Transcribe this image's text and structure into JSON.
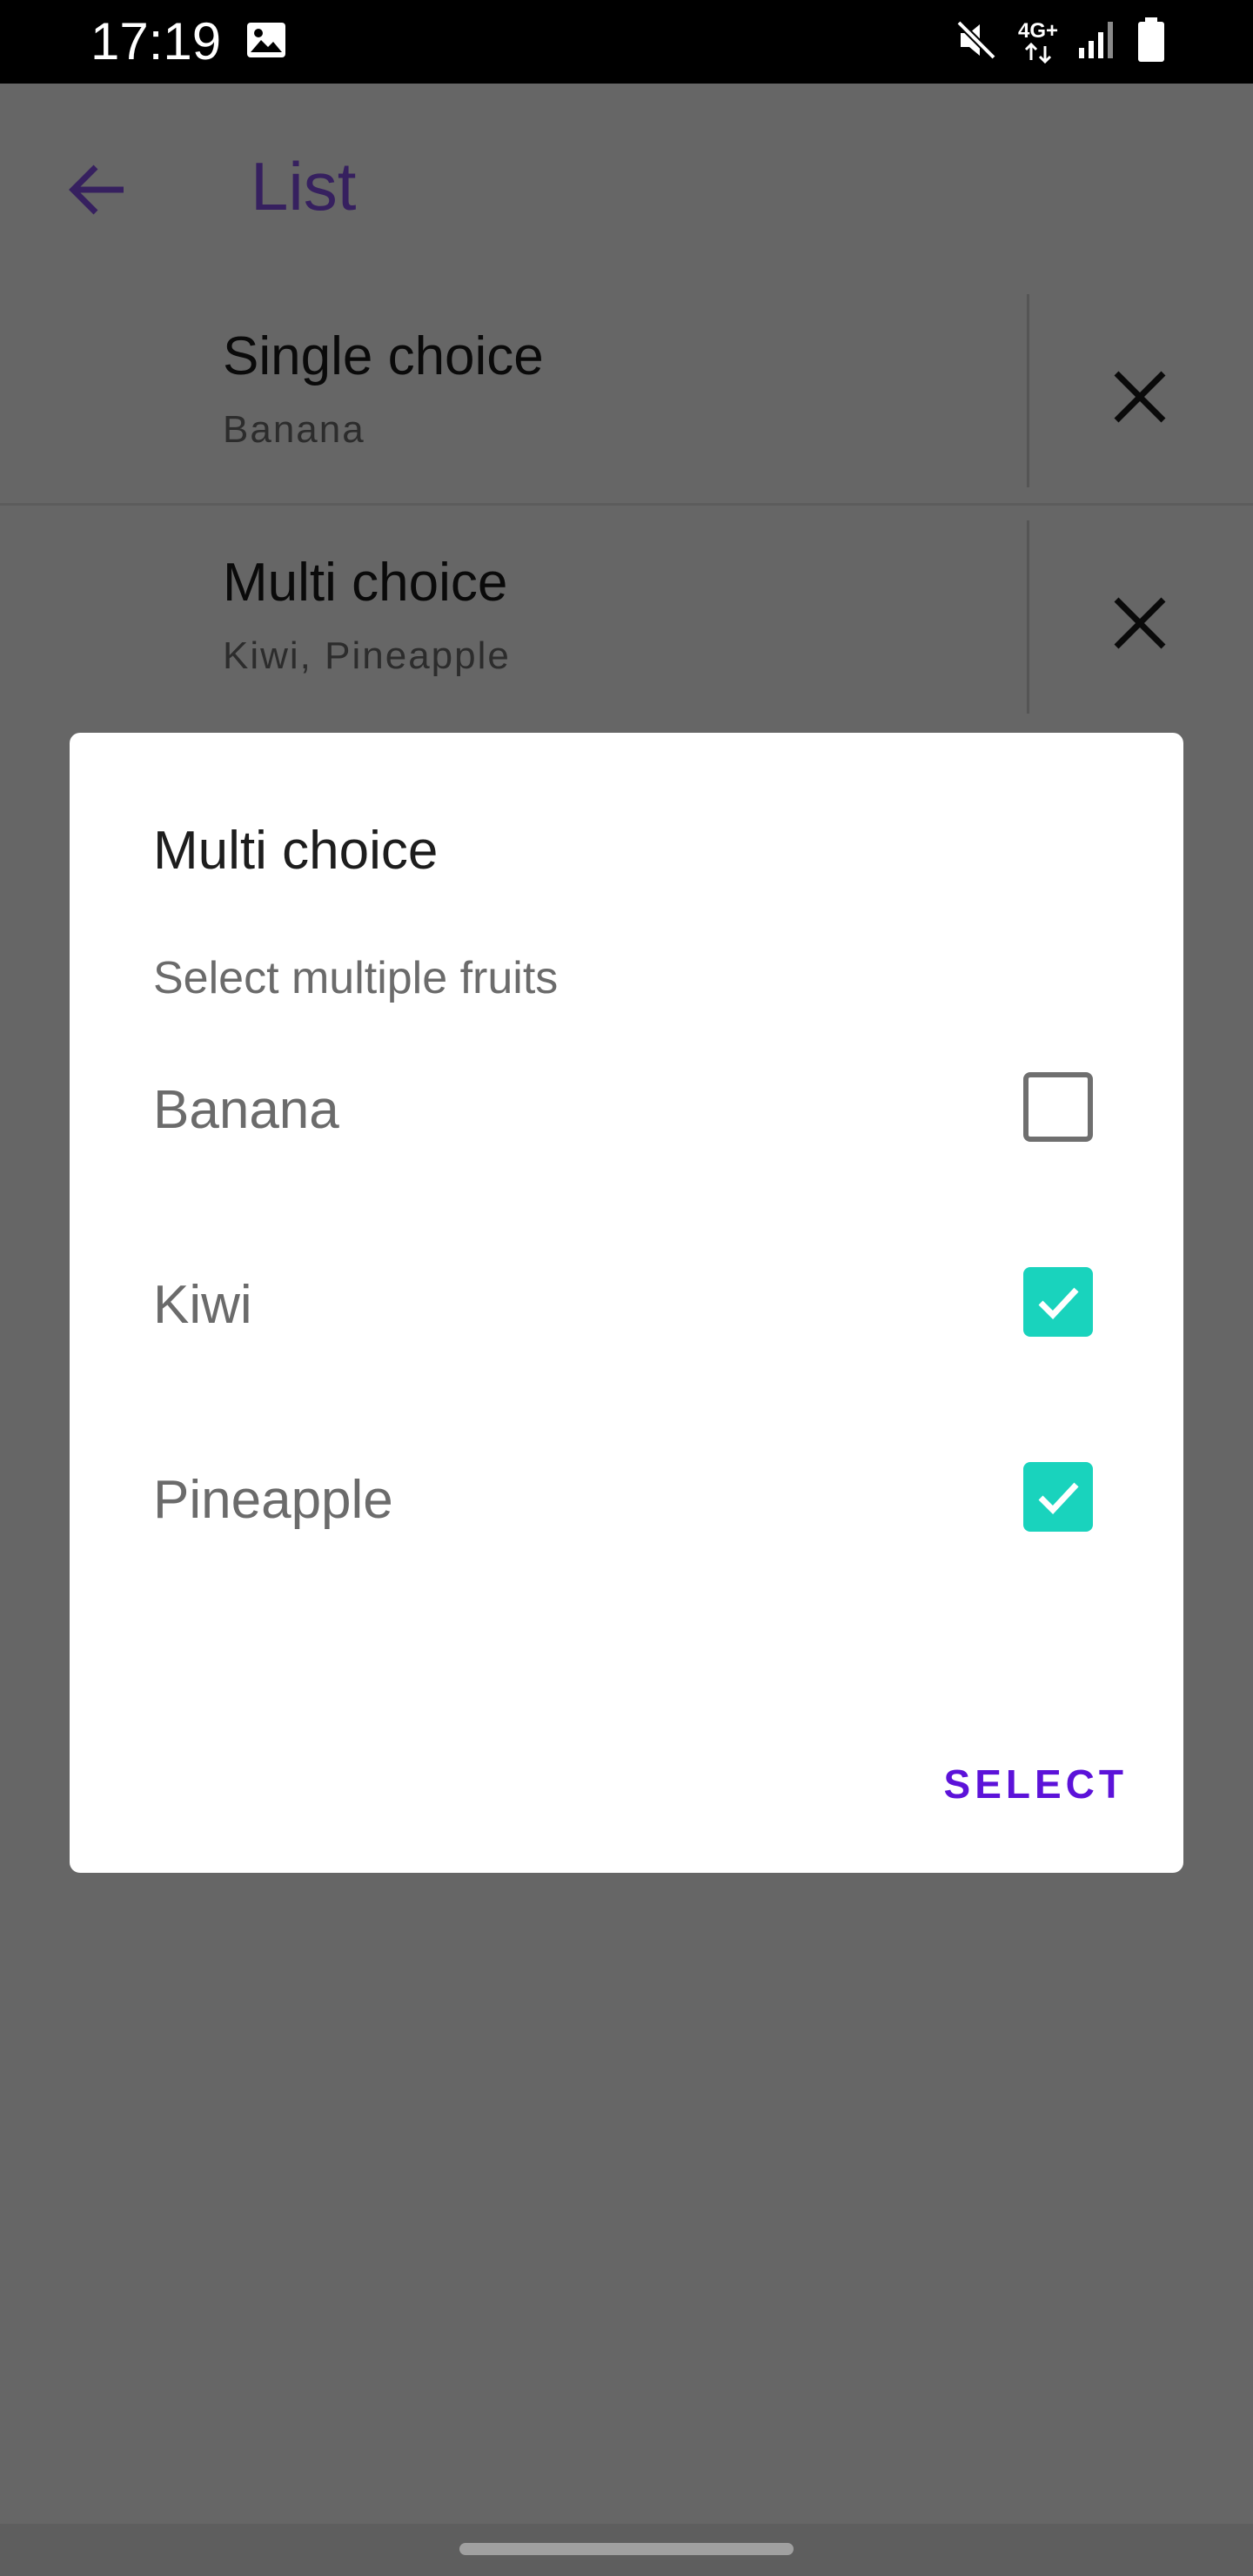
{
  "status_bar": {
    "time": "17:19",
    "network": "4G+",
    "icons": [
      "gallery-icon",
      "mute-icon",
      "network-4g-icon",
      "signal-icon",
      "battery-icon"
    ]
  },
  "app_bar": {
    "title": "List",
    "back_icon": "arrow-back-icon"
  },
  "list": [
    {
      "title": "Single choice",
      "subtitle": "Banana",
      "clear_icon": "close-icon"
    },
    {
      "title": "Multi choice",
      "subtitle": "Kiwi, Pineapple",
      "clear_icon": "close-icon"
    }
  ],
  "dialog": {
    "title": "Multi choice",
    "message": "Select multiple fruits",
    "options": [
      {
        "label": "Banana",
        "checked": false
      },
      {
        "label": "Kiwi",
        "checked": true
      },
      {
        "label": "Pineapple",
        "checked": true
      }
    ],
    "confirm_label": "SELECT"
  },
  "colors": {
    "accent": "#5c12d9",
    "checkbox_checked": "#19d3bd",
    "scrim": "#666666",
    "dialog_bg": "#ffffff"
  }
}
